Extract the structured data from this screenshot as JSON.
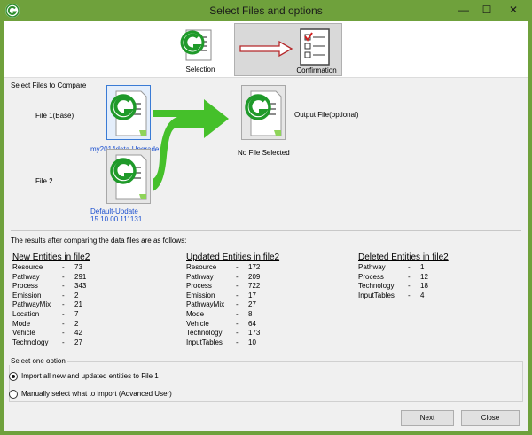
{
  "window": {
    "title": "Select Files and options",
    "min_glyph": "—",
    "max_glyph": "☐",
    "close_glyph": "✕",
    "frame_color": "#6fa13c"
  },
  "steps": {
    "selection": "Selection",
    "confirmation": "Confirmation"
  },
  "files": {
    "section_label": "Select Files to Compare",
    "file1_label": "File 1(Base)",
    "file1_name": "my2014data-Upgrade",
    "file2_label": "File 2",
    "file2_name": "Default-Update",
    "file2_sub": "15 10 00 111131",
    "output_label": "Output File(optional)",
    "output_status": "No File Selected",
    "arrow_color": "#45c02a"
  },
  "results": {
    "intro": "The results after comparing the data files are as follows:",
    "new": {
      "heading": "New Entities in file2",
      "rows": [
        {
          "name": "Resource",
          "value": "73"
        },
        {
          "name": "Pathway",
          "value": "291"
        },
        {
          "name": "Process",
          "value": "343"
        },
        {
          "name": "Emission",
          "value": "2"
        },
        {
          "name": "PathwayMix",
          "value": "21"
        },
        {
          "name": "Location",
          "value": "7"
        },
        {
          "name": "Mode",
          "value": "2"
        },
        {
          "name": "Vehicle",
          "value": "42"
        },
        {
          "name": "Technology",
          "value": "27"
        }
      ]
    },
    "updated": {
      "heading": "Updated Entities in file2",
      "rows": [
        {
          "name": "Resource",
          "value": "172"
        },
        {
          "name": "Pathway",
          "value": "209"
        },
        {
          "name": "Process",
          "value": "722"
        },
        {
          "name": "Emission",
          "value": "17"
        },
        {
          "name": "PathwayMix",
          "value": "27"
        },
        {
          "name": "Mode",
          "value": "8"
        },
        {
          "name": "Vehicle",
          "value": "64"
        },
        {
          "name": "Technology",
          "value": "173"
        },
        {
          "name": "InputTables",
          "value": "10"
        }
      ]
    },
    "deleted": {
      "heading": "Deleted Entities in file2",
      "rows": [
        {
          "name": "Pathway",
          "value": "1"
        },
        {
          "name": "Process",
          "value": "12"
        },
        {
          "name": "Technology",
          "value": "18"
        },
        {
          "name": "InputTables",
          "value": "4"
        }
      ]
    },
    "dash": "-"
  },
  "options": {
    "legend": "Select one option",
    "import_all": "Import all new and updated entities to File 1",
    "manual": "Manually select what to import (Advanced User)",
    "selected": "import_all"
  },
  "buttons": {
    "next": "Next",
    "close": "Close"
  }
}
